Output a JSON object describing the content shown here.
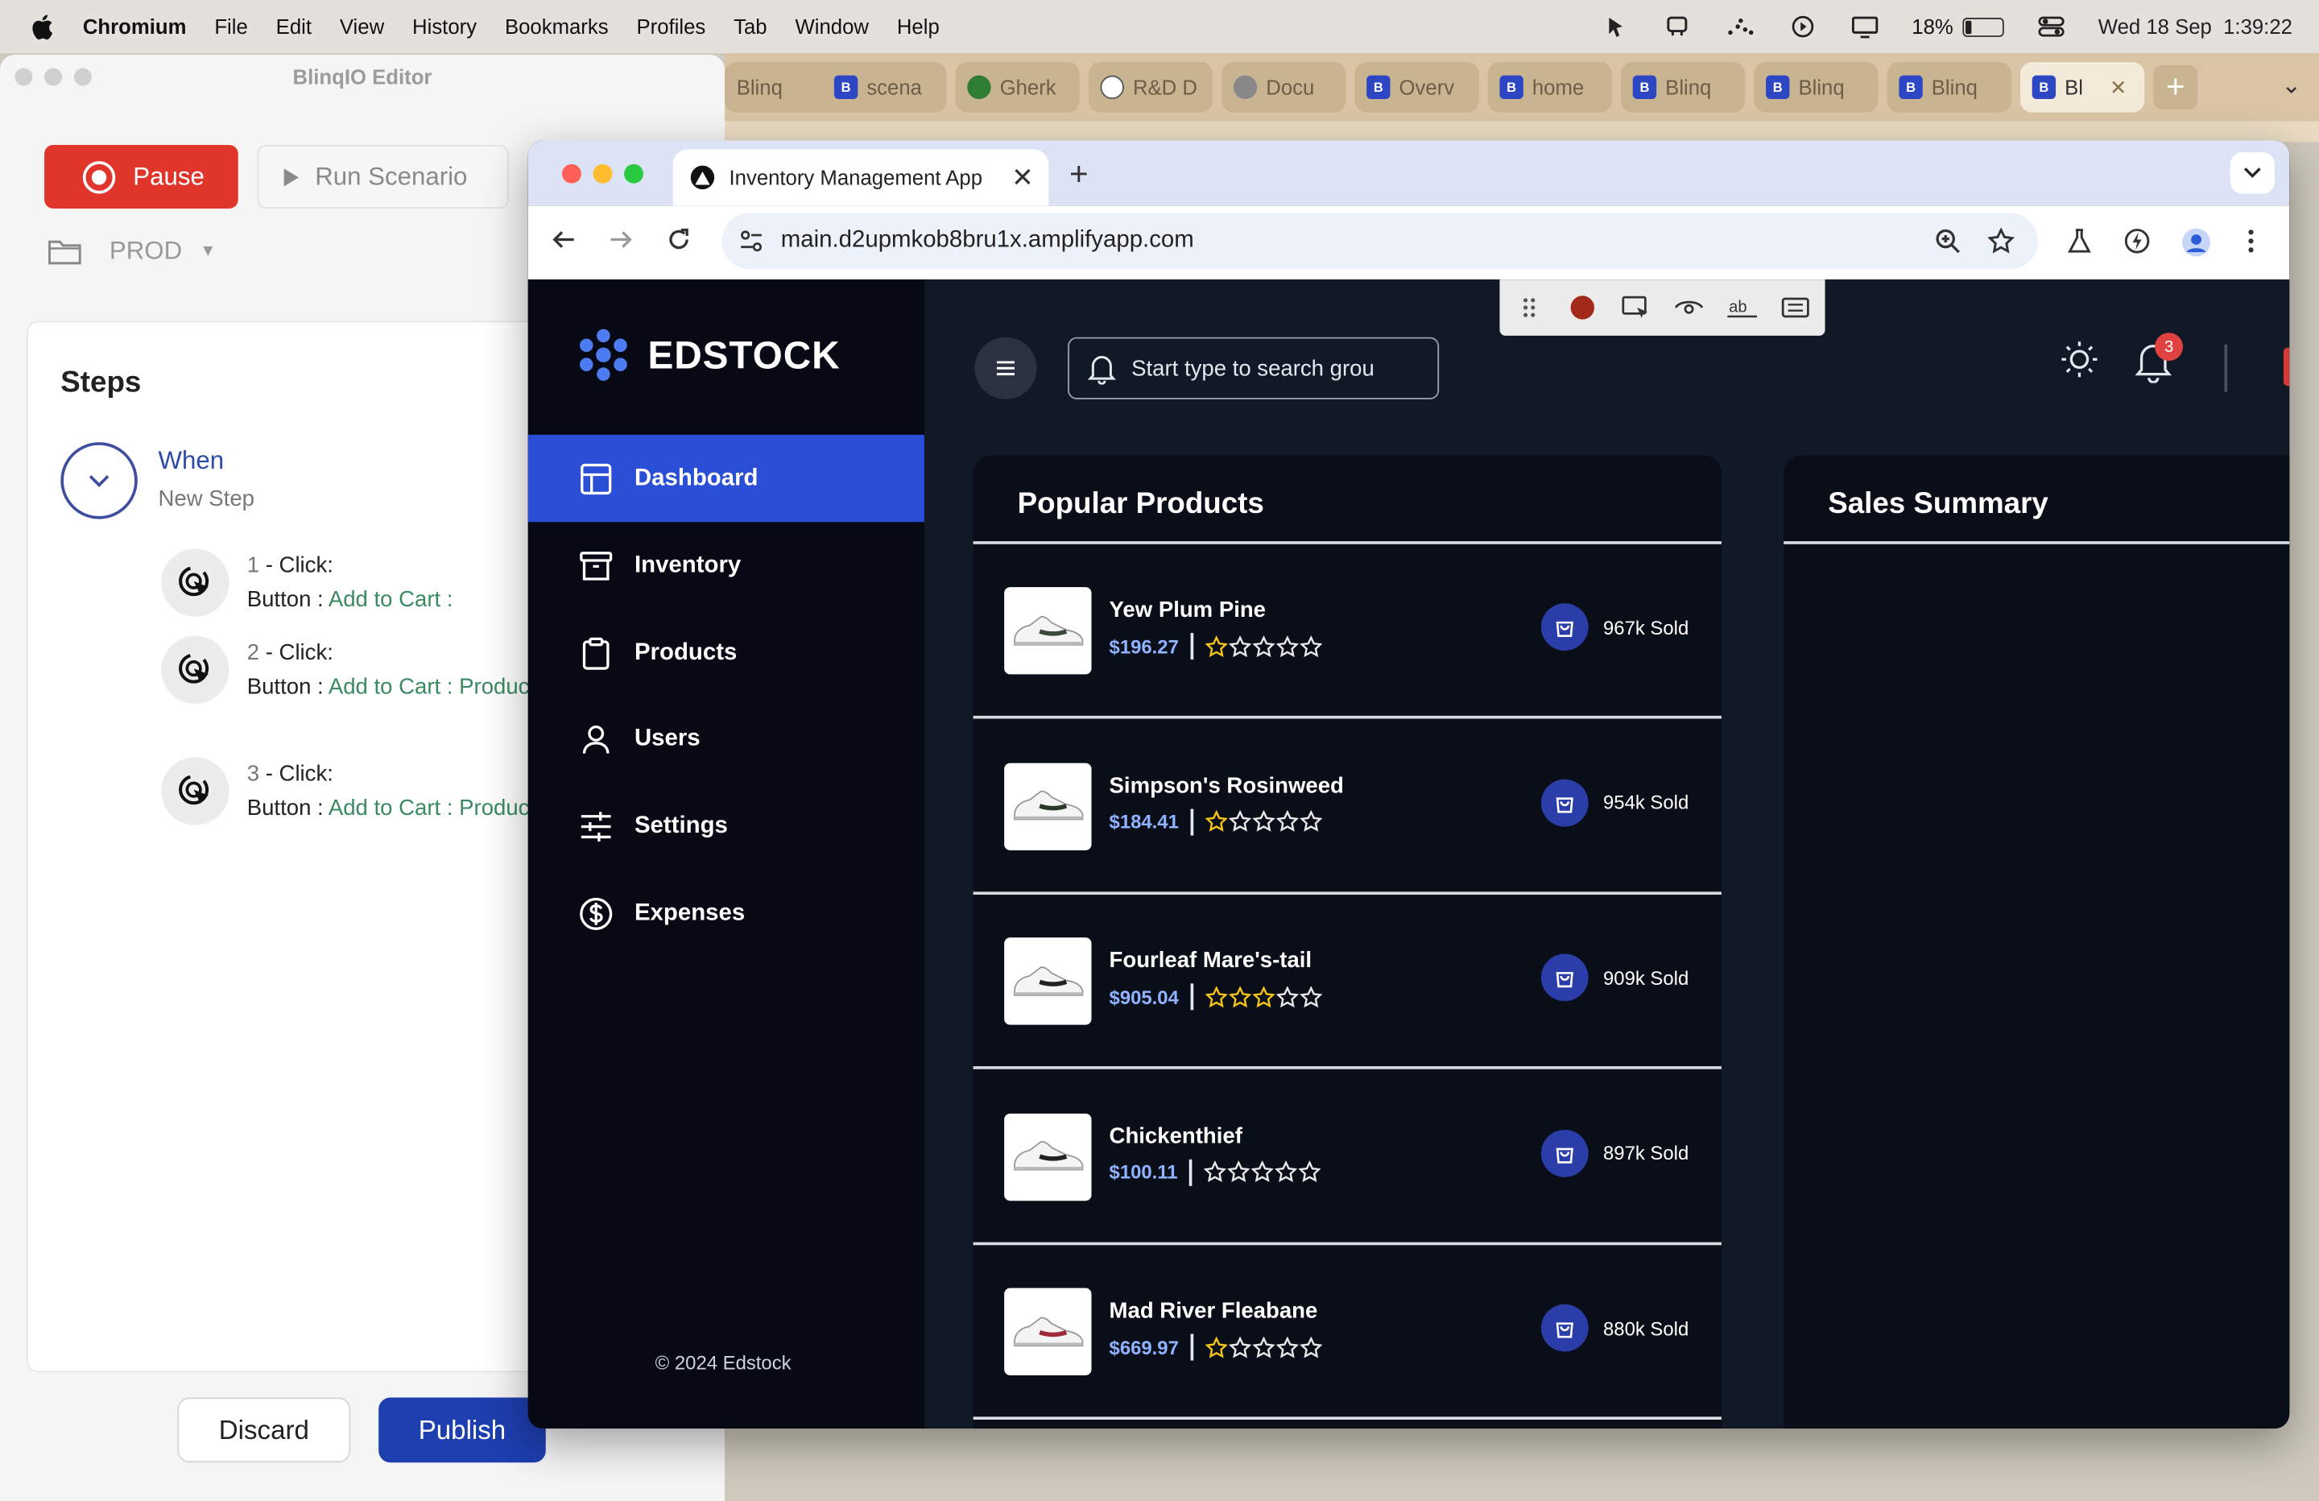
{
  "menubar": {
    "app_name": "Chromium",
    "items": [
      "File",
      "Edit",
      "View",
      "History",
      "Bookmarks",
      "Profiles",
      "Tab",
      "Window",
      "Help"
    ],
    "battery_percent": "18%",
    "battery_level": 0.18,
    "datetime": "Wed 18 Sep  1:39:22"
  },
  "back_browser": {
    "tabs": [
      "Blinq",
      "scena",
      "Gherk",
      "R&D D",
      "Docu",
      "Overv",
      "home",
      "Blinq",
      "Blinq",
      "Blinq",
      "Bl"
    ]
  },
  "editor": {
    "title": "BlinqIO Editor",
    "pause_label": "Pause",
    "run_label": "Run Scenario",
    "env_label": "PROD",
    "steps_heading": "Steps",
    "when_title": "When",
    "when_subtitle": "New Step",
    "steps": [
      {
        "num": "1",
        "action": " - Click:",
        "prefix": "Button : ",
        "target": "Add to Cart :"
      },
      {
        "num": "2",
        "action": " - Click:",
        "prefix": "Button : ",
        "target": "Add to Cart : Product Page"
      },
      {
        "num": "3",
        "action": " - Click:",
        "prefix": "Button : ",
        "target": "Add to Cart : Product Page"
      }
    ],
    "discard_label": "Discard",
    "publish_label": "Publish"
  },
  "browser": {
    "tab_title": "Inventory Management App",
    "url": "main.d2upmkob8bru1x.amplifyapp.com"
  },
  "app": {
    "brand": "EDSTOCK",
    "nav": [
      {
        "label": "Dashboard",
        "icon": "layout-icon",
        "active": true
      },
      {
        "label": "Inventory",
        "icon": "archive-icon",
        "active": false
      },
      {
        "label": "Products",
        "icon": "clipboard-icon",
        "active": false
      },
      {
        "label": "Users",
        "icon": "user-icon",
        "active": false
      },
      {
        "label": "Settings",
        "icon": "sliders-icon",
        "active": false
      },
      {
        "label": "Expenses",
        "icon": "dollar-circle-icon",
        "active": false
      }
    ],
    "copyright": "© 2024 Edstock",
    "search_placeholder": "Start type to search grou",
    "notification_count": "3",
    "popular_title": "Popular Products",
    "sales_title": "Sales Summary",
    "products": [
      {
        "name": "Yew Plum Pine",
        "price": "$196.27",
        "rating": 1,
        "sold": "967k Sold"
      },
      {
        "name": "Simpson's Rosinweed",
        "price": "$184.41",
        "rating": 1,
        "sold": "954k Sold"
      },
      {
        "name": "Fourleaf Mare's-tail",
        "price": "$905.04",
        "rating": 3,
        "sold": "909k Sold"
      },
      {
        "name": "Chickenthief",
        "price": "$100.11",
        "rating": 0,
        "sold": "897k Sold"
      },
      {
        "name": "Mad River Fleabane",
        "price": "$669.97",
        "rating": 1,
        "sold": "880k Sold"
      }
    ],
    "colors": {
      "accent": "#2b4ed6",
      "price": "#8fb3ff",
      "star": "#f5c518"
    }
  }
}
